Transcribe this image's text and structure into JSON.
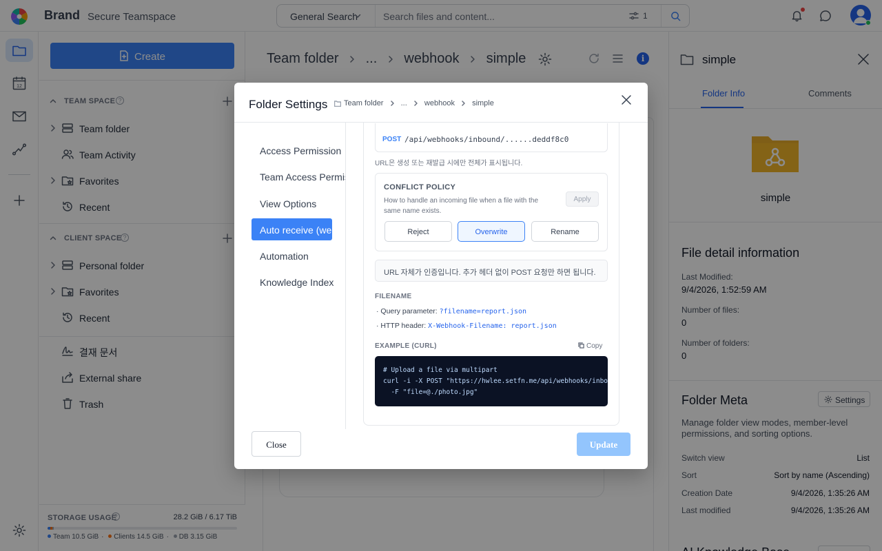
{
  "app": {
    "brand": "Brand",
    "teamspace": "Secure Teamspace"
  },
  "search": {
    "scope": "General Search",
    "placeholder": "Search files and content...",
    "filter_count": "1"
  },
  "sidebar": {
    "create_label": "Create",
    "team_space_title": "TEAM SPACE",
    "team_items": [
      {
        "label": "Team folder"
      },
      {
        "label": "Team Activity"
      },
      {
        "label": "Favorites"
      },
      {
        "label": "Recent"
      }
    ],
    "client_space_title": "CLIENT SPACE",
    "client_items": [
      {
        "label": "Personal folder"
      },
      {
        "label": "Favorites"
      },
      {
        "label": "Recent"
      }
    ],
    "other_items": [
      {
        "label": "결재 문서"
      },
      {
        "label": "External share"
      },
      {
        "label": "Trash"
      }
    ],
    "help_glyph": "?"
  },
  "storage": {
    "title": "STORAGE USAGE",
    "total": "28.2 GiB / 6.17 TiB",
    "legend": [
      {
        "name": "Team",
        "size": "10.5 GiB",
        "color": "#3b82f6"
      },
      {
        "name": "Clients",
        "size": "14.5 GiB",
        "color": "#f97316"
      },
      {
        "name": "DB",
        "size": "3.15 GiB",
        "color": "#9ca3af"
      }
    ],
    "sep": "·"
  },
  "main": {
    "breadcrumb": [
      "Team folder",
      "...",
      "webhook",
      "simple"
    ],
    "info_glyph": "i"
  },
  "right_panel": {
    "title": "simple",
    "tabs": [
      "Folder Info",
      "Comments"
    ],
    "folder_name": "simple",
    "detail_title": "File detail information",
    "last_modified_label": "Last Modified:",
    "last_modified_value": "9/4/2026, 1:52:59 AM",
    "num_files_label": "Number of files:",
    "num_files_value": "0",
    "num_folders_label": "Number of folders:",
    "num_folders_value": "0",
    "meta_title": "Folder Meta",
    "settings_label": "Settings",
    "meta_desc": "Manage folder view modes, member-level permissions, and sorting options.",
    "rows": [
      {
        "k": "Switch view",
        "v": "List"
      },
      {
        "k": "Sort",
        "v": "Sort by name (Ascending)"
      },
      {
        "k": "Creation Date",
        "v": "9/4/2026, 1:35:26 AM"
      },
      {
        "k": "Last modified",
        "v": "9/4/2026, 1:35:26 AM"
      }
    ],
    "ai_title": "AI Knowledge Base"
  },
  "modal": {
    "title": "Folder Settings",
    "breadcrumb": [
      "Team folder",
      "...",
      "webhook",
      "simple"
    ],
    "nav": [
      {
        "label": "Access Permission"
      },
      {
        "label": "Team Access Permission"
      },
      {
        "label": "View Options"
      },
      {
        "label": "Auto receive (webhook)"
      },
      {
        "label": "Automation"
      },
      {
        "label": "Knowledge Index"
      }
    ],
    "url_method": "POST",
    "url_path": "/api/webhooks/inbound/......deddf8c0",
    "url_note": "URL은 생성 또는 재발급 시에만 전체가 표시됩니다.",
    "conflict_title": "CONFLICT POLICY",
    "conflict_desc": "How to handle an incoming file when a file with the same name exists.",
    "apply_label": "Apply",
    "options": [
      "Reject",
      "Overwrite",
      "Rename"
    ],
    "auth_note": "URL 자체가 인증입니다. 추가 헤더 없이 POST 요청만 하면 됩니다.",
    "filename_title": "FILENAME",
    "fn_rows": [
      {
        "label": "· Query parameter: ",
        "code": "?filename=report.json"
      },
      {
        "label": "· HTTP header: ",
        "code": "X-Webhook-Filename: report.json"
      }
    ],
    "example_title": "EXAMPLE (CURL)",
    "copy_label": "Copy",
    "code": "# Upload a file via multipart\ncurl -i -X POST \"https://hwlee.setfn.me/api/webhooks/inbound\n  -F \"file=@./photo.jpg\"",
    "close_label": "Close",
    "update_label": "Update"
  }
}
